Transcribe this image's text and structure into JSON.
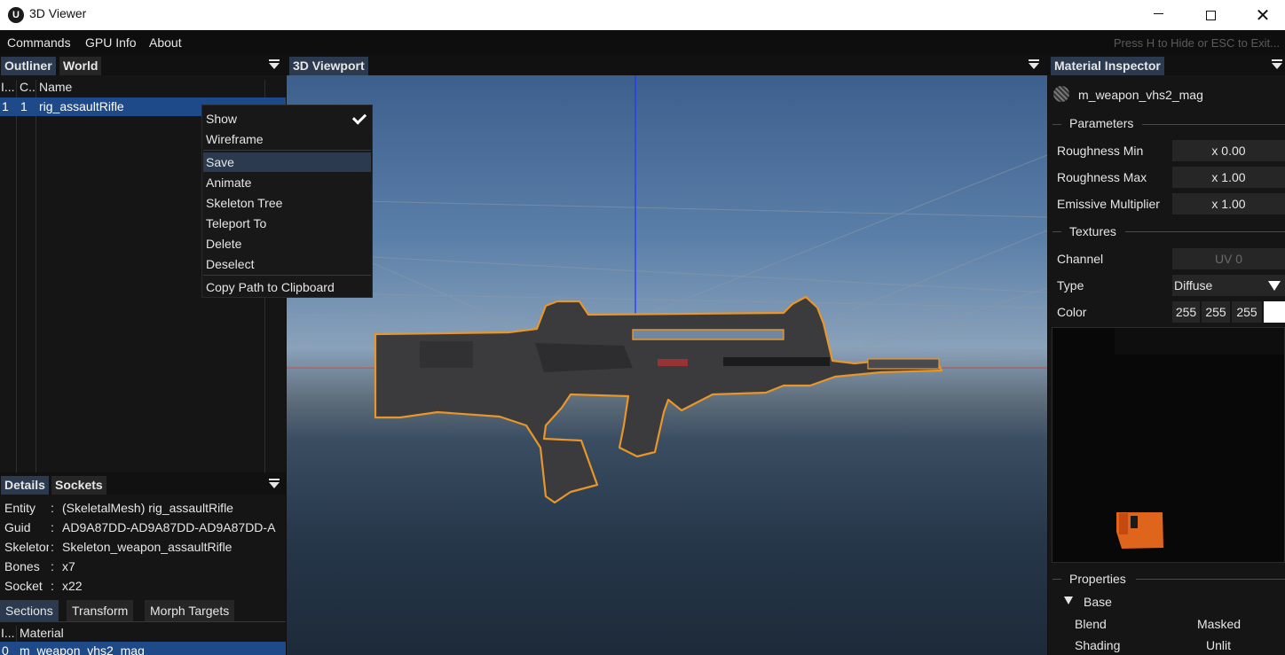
{
  "window": {
    "title": "3D Viewer",
    "app_icon": "U"
  },
  "menu": {
    "items": [
      "Commands",
      "GPU Info",
      "About"
    ],
    "hint": "Press H to Hide or ESC to Exit..."
  },
  "outliner": {
    "tabs": [
      "Outliner",
      "World"
    ],
    "columns": [
      "I...",
      "C...",
      "Name"
    ],
    "rows": [
      {
        "index": "1",
        "count": "1",
        "name": "rig_assaultRifle"
      }
    ]
  },
  "context_menu": {
    "items": [
      "Show",
      "Wireframe",
      "Save",
      "Animate",
      "Skeleton Tree",
      "Teleport To",
      "Delete",
      "Deselect",
      "Copy Path to Clipboard"
    ],
    "checked": "Show",
    "highlighted": "Save"
  },
  "details": {
    "tabs": [
      "Details",
      "Sockets"
    ],
    "fields": [
      {
        "key": "Entity",
        "value": "(SkeletalMesh) rig_assaultRifle"
      },
      {
        "key": "Guid",
        "value": "AD9A87DD-AD9A87DD-AD9A87DD-A"
      },
      {
        "key": "Skeleton",
        "value": "Skeleton_weapon_assaultRifle"
      },
      {
        "key": "Bones",
        "value": "x7"
      },
      {
        "key": "Socket",
        "value": "x22"
      }
    ],
    "subtabs": [
      "Sections",
      "Transform",
      "Morph Targets"
    ],
    "section_columns": [
      "I...",
      "Material"
    ],
    "section_rows": [
      {
        "index": "0",
        "material": "m_weapon_vhs2_mag"
      }
    ]
  },
  "viewport": {
    "tab": "3D Viewport"
  },
  "inspector": {
    "tab": "Material Inspector",
    "material_name": "m_weapon_vhs2_mag",
    "parameters_label": "Parameters",
    "parameters": [
      {
        "label": "Roughness Min",
        "value": "x 0.00"
      },
      {
        "label": "Roughness Max",
        "value": "x 1.00"
      },
      {
        "label": "Emissive Multiplier",
        "value": "x 1.00"
      }
    ],
    "textures_label": "Textures",
    "channel_label": "Channel",
    "channel_value": "UV 0",
    "type_label": "Type",
    "type_value": "Diffuse",
    "color_label": "Color",
    "color_values": [
      "255",
      "255",
      "255"
    ],
    "properties_label": "Properties",
    "base_label": "Base",
    "base_props": [
      {
        "label": "Blend",
        "value": "Masked"
      },
      {
        "label": "Shading",
        "value": "Unlit"
      }
    ]
  },
  "colors": {
    "selection": "#1f4a8a",
    "tab_active": "#2b3a4e",
    "outline": "#e8962a",
    "texture_orange": "#e0651c"
  }
}
